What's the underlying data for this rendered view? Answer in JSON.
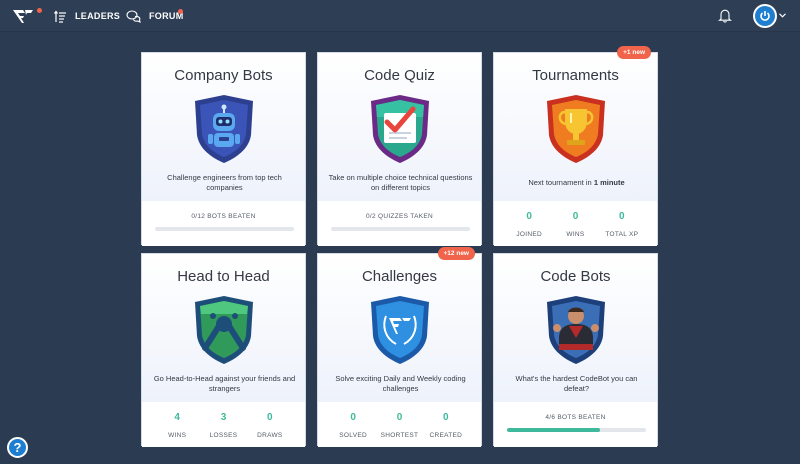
{
  "nav": {
    "leaders": "LEADERS",
    "forum": "FORUM"
  },
  "colors": {
    "accent": "#3fb99c",
    "notification": "#f0644b",
    "brand_blue": "#1e7fd0"
  },
  "cards": [
    {
      "title": "Company Bots",
      "desc": "Challenge engineers from top tech companies",
      "progress_text": "0/12  BOTS BEATEN",
      "progress": 0
    },
    {
      "title": "Code Quiz",
      "desc": "Take on multiple choice technical questions on different topics",
      "progress_text": "0/2  QUIZZES TAKEN",
      "progress": 0
    },
    {
      "title": "Tournaments",
      "badge": "+1 new",
      "desc_prefix": "Next tournament in",
      "desc_bold": "1 minute",
      "stats": [
        {
          "value": "0",
          "label": "JOINED"
        },
        {
          "value": "0",
          "label": "WINS"
        },
        {
          "value": "0",
          "label": "TOTAL XP"
        }
      ]
    },
    {
      "title": "Head to Head",
      "desc": "Go Head-to-Head against your friends and strangers",
      "stats": [
        {
          "value": "4",
          "label": "WINS"
        },
        {
          "value": "3",
          "label": "LOSSES"
        },
        {
          "value": "0",
          "label": "DRAWS"
        }
      ]
    },
    {
      "title": "Challenges",
      "badge": "+12 new",
      "desc": "Solve exciting Daily and Weekly coding challenges",
      "stats": [
        {
          "value": "0",
          "label": "SOLVED"
        },
        {
          "value": "0",
          "label": "SHORTEST"
        },
        {
          "value": "0",
          "label": "CREATED"
        }
      ]
    },
    {
      "title": "Code Bots",
      "desc": "What's the hardest CodeBot you can defeat?",
      "progress_text": "4/6  BOTS BEATEN",
      "progress": 0.667
    }
  ],
  "help": "?"
}
